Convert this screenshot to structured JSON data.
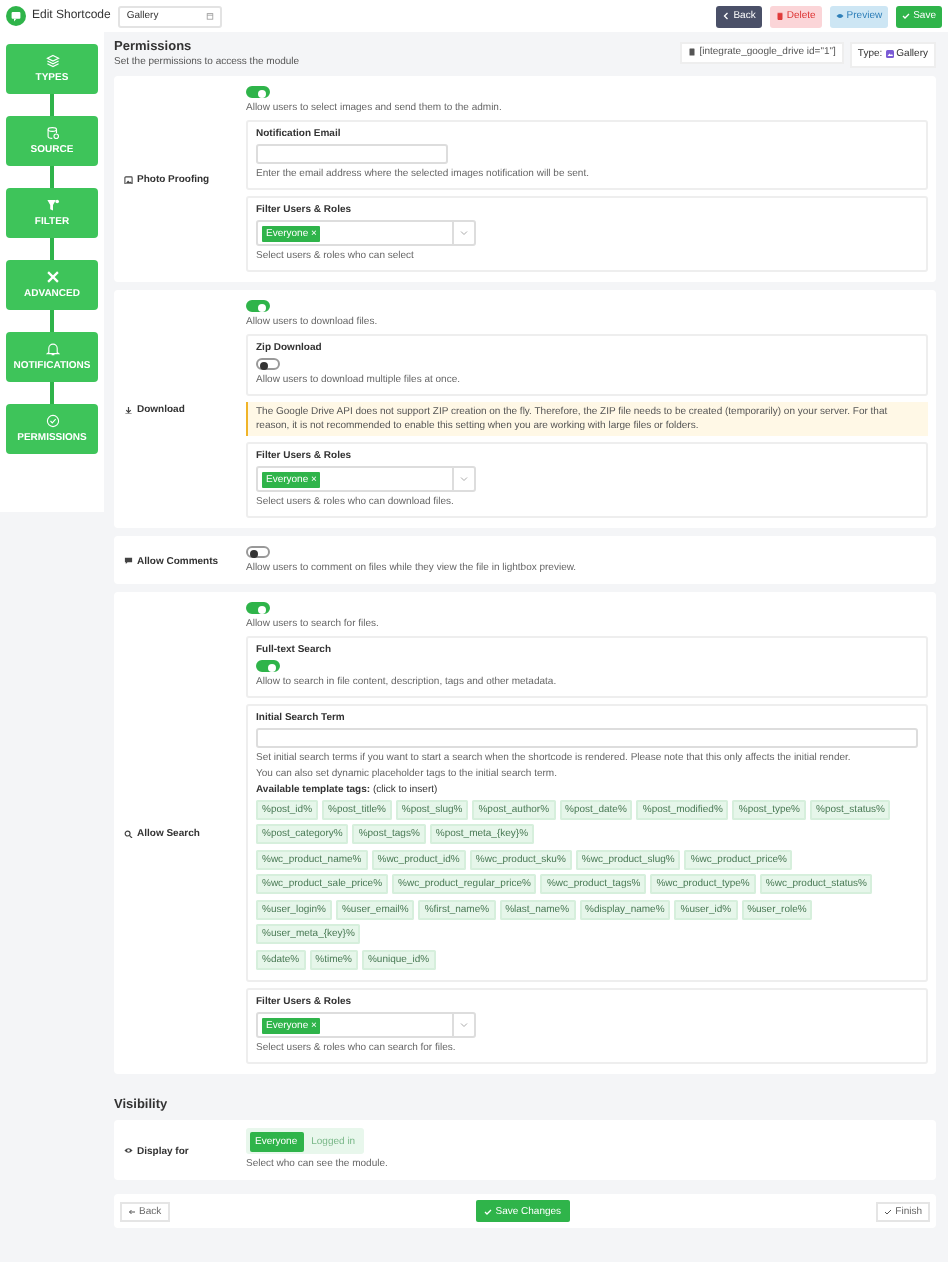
{
  "header": {
    "title": "Edit Shortcode",
    "name_field": "Gallery",
    "buttons": [
      {
        "label": "Back",
        "kind": "back"
      },
      {
        "label": "Delete",
        "kind": "delete"
      },
      {
        "label": "Preview",
        "kind": "preview"
      },
      {
        "label": "Save",
        "kind": "save"
      }
    ]
  },
  "steps": [
    {
      "label": "TYPES",
      "kind": "types"
    },
    {
      "label": "SOURCE",
      "kind": "source"
    },
    {
      "label": "FILTER",
      "kind": "filter"
    },
    {
      "label": "ADVANCED",
      "kind": "advanced"
    },
    {
      "label": "NOTIFICATIONS",
      "kind": "notifications"
    },
    {
      "label": "PERMISSIONS",
      "kind": "permissions"
    }
  ],
  "page": {
    "title": "Permissions",
    "subtitle": "Set the permissions to access the module",
    "shortcode": "[integrate_google_drive id=\"1\"]",
    "type_label": "Type:",
    "type_value": "Gallery"
  },
  "sections": [
    {
      "label": "Photo Proofing",
      "kind": "image",
      "on": true,
      "description": "Allow users to select images and send them to the admin.",
      "fields": [
        {
          "kind": "text",
          "title": "Notification Email",
          "description": "Enter the email address where the selected images notification will be sent."
        },
        {
          "kind": "roles",
          "title": "Filter Users & Roles",
          "tags": [
            {
              "label": "Everyone",
              "remove": "×"
            }
          ],
          "description": "Select users & roles who can select"
        }
      ]
    },
    {
      "label": "Download",
      "kind": "download",
      "on": true,
      "description": "Allow users to download files.",
      "fields": [
        {
          "kind": "toggle",
          "title": "Zip Download",
          "on": false,
          "description": "Allow users to download multiple files at once."
        },
        {
          "kind": "notice",
          "text": "The Google Drive API does not support ZIP creation on the fly. Therefore, the ZIP file needs to be created (temporarily) on your server. For that reason, it is not recommended to enable this setting when you are working with large files or folders."
        },
        {
          "kind": "roles",
          "title": "Filter Users & Roles",
          "tags": [
            {
              "label": "Everyone",
              "remove": "×"
            }
          ],
          "description": "Select users & roles who can download files."
        }
      ]
    },
    {
      "label": "Allow Comments",
      "kind": "comment",
      "on": false,
      "description": "Allow users to comment on files while they view the file in lightbox preview."
    },
    {
      "label": "Allow Search",
      "kind": "search",
      "on": true,
      "description": "Allow users to search for files.",
      "fields": [
        {
          "kind": "toggle",
          "title": "Full-text Search",
          "on": true,
          "description": "Allow to search in file content, description, tags and other metadata."
        },
        {
          "kind": "search_term",
          "title": "Initial Search Term",
          "description": "Set initial search terms if you want to start a search when the shortcode is rendered. Please note that this only affects the initial render.",
          "note": "You can also set dynamic placeholder tags to the initial search term.",
          "tags_heading": "**Available template tags:** (click to insert)",
          "tag_groups": [
            [
              "%post_id%",
              "%post_title%",
              "%post_slug%",
              "%post_author%",
              "%post_date%",
              "%post_modified%",
              "%post_type%",
              "%post_status%",
              "%post_category%",
              "%post_tags%",
              "%post_meta_{key}%"
            ],
            [
              "%wc_product_name%",
              "%wc_product_id%",
              "%wc_product_sku%",
              "%wc_product_slug%",
              "%wc_product_price%",
              "%wc_product_sale_price%",
              "%wc_product_regular_price%",
              "%wc_product_tags%",
              "%wc_product_type%",
              "%wc_product_status%"
            ],
            [
              "%user_login%",
              "%user_email%",
              "%first_name%",
              "%last_name%",
              "%display_name%",
              "%user_id%",
              "%user_role%",
              "%user_meta_{key}%"
            ],
            [
              "%date%",
              "%time%",
              "%unique_id%"
            ]
          ]
        },
        {
          "kind": "roles",
          "title": "Filter Users & Roles",
          "tags": [
            {
              "label": "Everyone",
              "remove": "×"
            }
          ],
          "description": "Select users & roles who can search for files."
        }
      ]
    }
  ],
  "visibility": {
    "title": "Visibility",
    "label": "Display for",
    "options": [
      {
        "label": "Everyone",
        "selected": true
      },
      {
        "label": "Logged in",
        "selected": false
      }
    ],
    "description": "Select who can see the module."
  },
  "footer": {
    "back": "Back",
    "save": "Save Changes",
    "finish": "Finish"
  }
}
